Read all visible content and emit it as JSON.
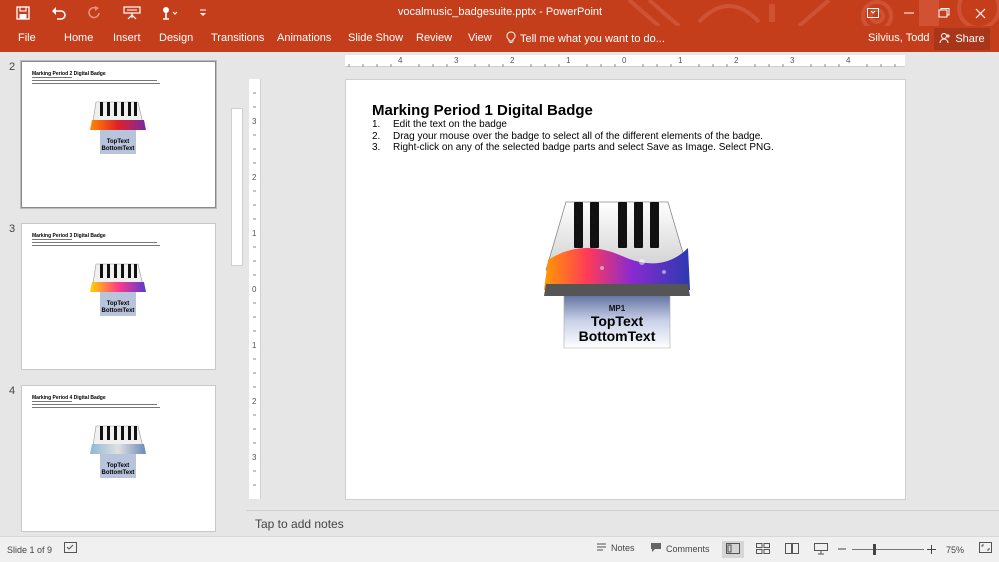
{
  "window": {
    "title": "vocalmusic_badgesuite.pptx - PowerPoint"
  },
  "quick_access": [
    "save-icon",
    "undo-icon",
    "redo-icon",
    "presenter-icon",
    "touch-mode-icon",
    "customize-icon"
  ],
  "ribbon": {
    "tabs": [
      "File",
      "Home",
      "Insert",
      "Design",
      "Transitions",
      "Animations",
      "Slide Show",
      "Review",
      "View"
    ],
    "tell_me": "Tell me what you want to do...",
    "user": "Silvius, Todd",
    "share": "Share"
  },
  "thumbnails": [
    {
      "number": "2",
      "title": "Marking Period 2 Digital Badge",
      "badge_top": "TopText",
      "badge_bottom": "BottomText"
    },
    {
      "number": "3",
      "title": "Marking Period 3 Digital Badge",
      "badge_top": "TopText",
      "badge_bottom": "BottomText"
    },
    {
      "number": "4",
      "title": "Marking Period 4 Digital Badge",
      "badge_top": "TopText",
      "badge_bottom": "BottomText"
    }
  ],
  "ruler": {
    "horizontal": [
      "4",
      "3",
      "2",
      "1",
      "0",
      "1",
      "2",
      "3",
      "4"
    ],
    "vertical": [
      "3",
      "2",
      "1",
      "0",
      "1",
      "2",
      "3"
    ]
  },
  "slide": {
    "title": "Marking Period 1 Digital Badge",
    "steps": [
      {
        "n": "1.",
        "text": "Edit the text on the badge"
      },
      {
        "n": "2.",
        "text": "Drag your mouse over the badge to select all of the different elements of the badge."
      },
      {
        "n": "3.",
        "text": "Right-click on any of the selected badge parts and select Save as Image. Select PNG."
      }
    ],
    "badge": {
      "label": "MP1",
      "top": "TopText",
      "bottom": "BottomText"
    }
  },
  "notes_placeholder": "Tap to add notes",
  "status": {
    "slide_counter": "Slide 1 of 9",
    "notes": "Notes",
    "comments": "Comments",
    "zoom": "75%"
  },
  "colors": {
    "accent": "#c43e1c",
    "share_button": "#a8361b"
  }
}
